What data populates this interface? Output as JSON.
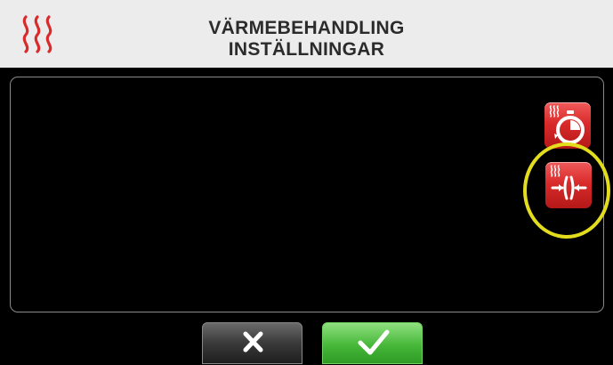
{
  "header": {
    "title_line1": "VÄRMEBEHANDLING",
    "title_line2": "INSTÄLLNINGAR",
    "icon": "heat-waves-icon"
  },
  "side_buttons": [
    {
      "icon": "heat-timer-icon"
    },
    {
      "icon": "heat-pressure-icon",
      "highlighted": true
    }
  ],
  "footer": {
    "cancel_icon": "close-icon",
    "confirm_icon": "checkmark-icon"
  },
  "colors": {
    "header_bg": "#ececec",
    "accent_red": "#d92b2b",
    "highlight_yellow": "#e3dd1e",
    "confirm_green": "#47b83a"
  }
}
